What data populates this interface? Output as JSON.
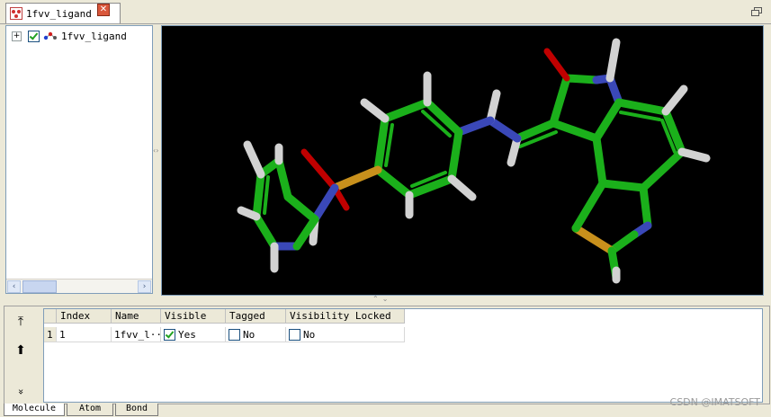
{
  "tab": {
    "title": "1fvv_ligand",
    "close_symbol": "✕"
  },
  "tree": {
    "expander": "+",
    "item_label": "1fvv_ligand",
    "item_checked": true,
    "scroll_left": "‹",
    "scroll_right": "›"
  },
  "splitters": {
    "vertical_arrows": "‹›",
    "horizontal_arrows": "⌃⌄"
  },
  "toolbar": {
    "move_top": "⤒",
    "move_up": "⬆",
    "expand": "»"
  },
  "table": {
    "columns": [
      "Index",
      "Name",
      "Visible",
      "Tagged",
      "Visibility Locked"
    ],
    "rows": [
      {
        "row_header": "1",
        "index": "1",
        "name": "1fvv_l···",
        "visible": "Yes",
        "visible_checked": true,
        "tagged": "No",
        "tagged_checked": false,
        "locked": "No",
        "locked_checked": false
      }
    ]
  },
  "bottom_tabs": [
    "Molecule",
    "Atom",
    "Bond"
  ],
  "watermark": "CSDN @IMATSOFT",
  "colors": {
    "carbon": "#1bb01b",
    "nitrogen": "#3a48b8",
    "oxygen": "#d40000",
    "sulfur": "#c8901c",
    "hydrogen": "#d6d6d6",
    "background": "#000000"
  }
}
